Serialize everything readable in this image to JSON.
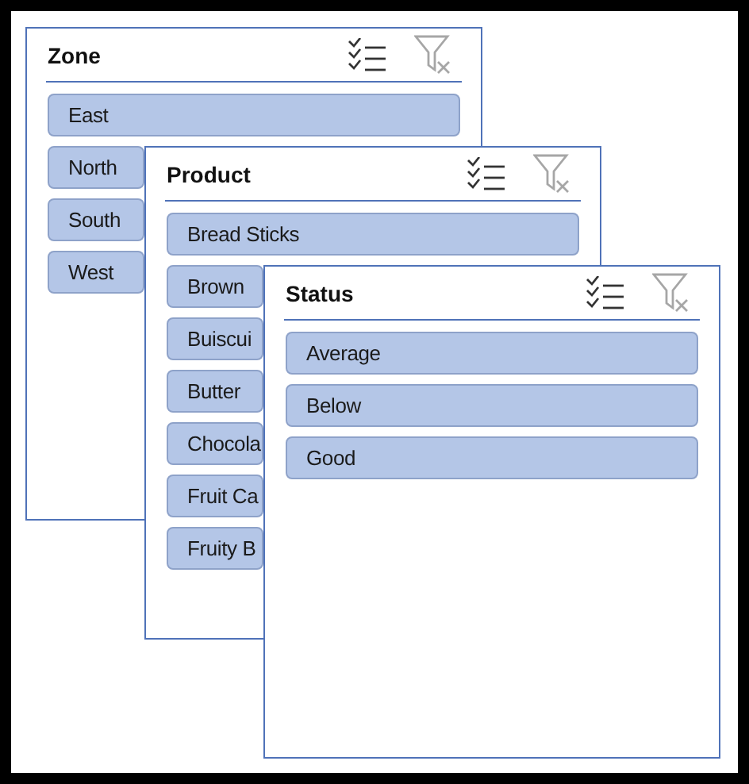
{
  "slicers": [
    {
      "title": "Zone",
      "items": [
        {
          "label": "East",
          "selected": true
        },
        {
          "label": "North",
          "selected": true
        },
        {
          "label": "South",
          "selected": true
        },
        {
          "label": "West",
          "selected": true
        }
      ]
    },
    {
      "title": "Product",
      "items": [
        {
          "label": "Bread Sticks",
          "selected": true
        },
        {
          "label": "Brown",
          "selected": true
        },
        {
          "label": "Buiscui",
          "selected": true
        },
        {
          "label": "Butter",
          "selected": true
        },
        {
          "label": "Chocola",
          "selected": true
        },
        {
          "label": "Fruit Ca",
          "selected": true
        },
        {
          "label": "Fruity B",
          "selected": true
        }
      ]
    },
    {
      "title": "Status",
      "items": [
        {
          "label": "Average",
          "selected": true
        },
        {
          "label": "Below",
          "selected": true
        },
        {
          "label": "Good",
          "selected": true
        }
      ]
    }
  ]
}
